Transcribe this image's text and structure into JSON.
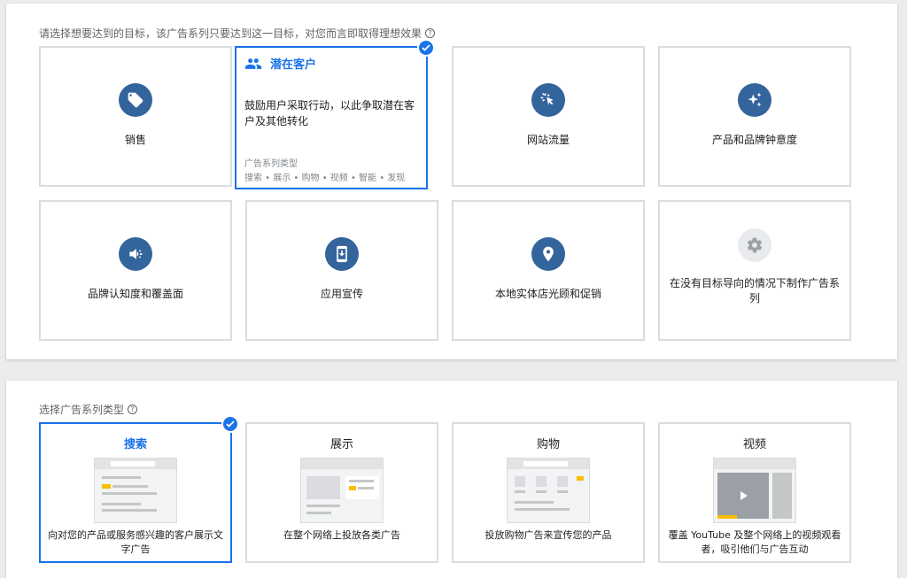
{
  "goal_section": {
    "prompt": "请选择想要达到的目标，该广告系列只要达到这一目标，对您而言即取得理想效果",
    "help": "?",
    "selected": {
      "title": "潜在客户",
      "description": "鼓励用户采取行动，以此争取潜在客户及其他转化",
      "types_label": "广告系列类型",
      "types": "搜索 • 展示 • 购物 • 视频 • 智能 • 发现"
    },
    "goals": [
      {
        "label": "销售",
        "icon": "tag-icon"
      },
      {
        "label": "潜在客户",
        "icon": "people-icon"
      },
      {
        "label": "网站流量",
        "icon": "cursor-click-icon"
      },
      {
        "label": "产品和品牌钟意度",
        "icon": "sparkle-icon"
      },
      {
        "label": "品牌认知度和覆盖面",
        "icon": "megaphone-icon"
      },
      {
        "label": "应用宣传",
        "icon": "phone-download-icon"
      },
      {
        "label": "本地实体店光顾和促销",
        "icon": "location-pin-icon"
      },
      {
        "label": "在没有目标导向的情况下制作广告系列",
        "icon": "gear-icon"
      }
    ]
  },
  "type_section": {
    "prompt": "选择广告系列类型",
    "help": "?",
    "types": [
      {
        "title": "搜索",
        "description": "向对您的产品或服务感兴趣的客户展示文字广告"
      },
      {
        "title": "展示",
        "description": "在整个网络上投放各类广告"
      },
      {
        "title": "购物",
        "description": "投放购物广告来宣传您的产品"
      },
      {
        "title": "视频",
        "description": "覆盖 YouTube 及整个网络上的视频观看者，吸引他们与广告互动"
      }
    ]
  },
  "colors": {
    "accent": "#1a73e8",
    "icon_circle": "#34649c",
    "border": "#dadce0"
  }
}
